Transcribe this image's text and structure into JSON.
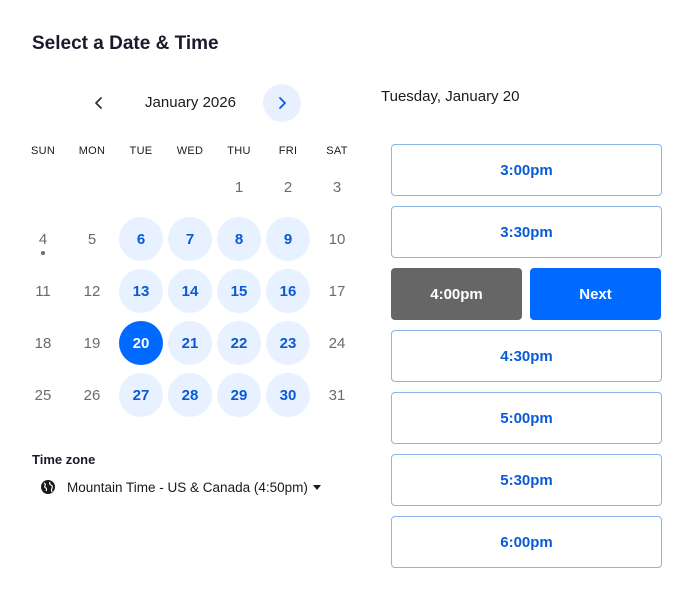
{
  "header": {
    "title": "Select a Date & Time"
  },
  "calendar": {
    "month_label": "January 2026",
    "weekdays": [
      "SUN",
      "MON",
      "TUE",
      "WED",
      "THU",
      "FRI",
      "SAT"
    ],
    "weeks": [
      [
        null,
        null,
        null,
        null,
        "1",
        "2",
        "3"
      ],
      [
        "4",
        "5",
        "6",
        "7",
        "8",
        "9",
        "10"
      ],
      [
        "11",
        "12",
        "13",
        "14",
        "15",
        "16",
        "17"
      ],
      [
        "18",
        "19",
        "20",
        "21",
        "22",
        "23",
        "24"
      ],
      [
        "25",
        "26",
        "27",
        "28",
        "29",
        "30",
        "31"
      ]
    ],
    "available_days": [
      "6",
      "7",
      "8",
      "9",
      "13",
      "14",
      "15",
      "16",
      "20",
      "21",
      "22",
      "23",
      "27",
      "28",
      "29",
      "30"
    ],
    "selected_day": "20",
    "today": "4"
  },
  "timezone": {
    "label": "Time zone",
    "value": "Mountain Time - US & Canada (4:50pm)"
  },
  "times": {
    "date_heading": "Tuesday, January 20",
    "slots": [
      {
        "label": "3:00pm"
      },
      {
        "label": "3:30pm"
      },
      {
        "label": "4:00pm",
        "selected": true
      },
      {
        "label": "4:30pm"
      },
      {
        "label": "5:00pm"
      },
      {
        "label": "5:30pm"
      },
      {
        "label": "6:00pm"
      }
    ],
    "next_label": "Next"
  },
  "colors": {
    "primary": "#0069ff",
    "available_bg": "#e8f1ff",
    "selected_slot": "#666666"
  }
}
